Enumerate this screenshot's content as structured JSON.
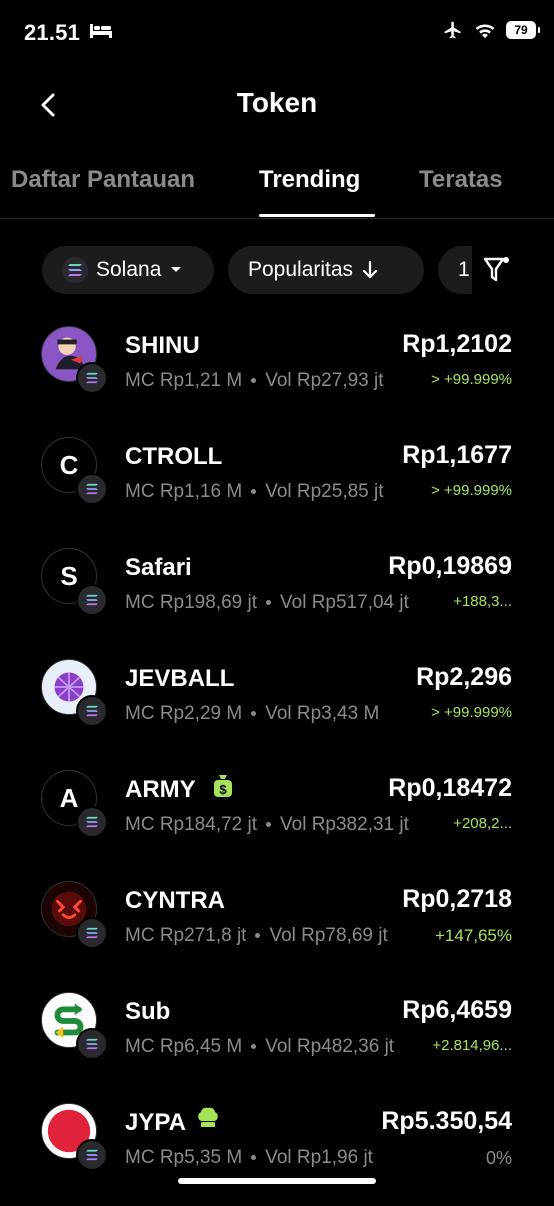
{
  "status": {
    "time": "21.51",
    "battery": "79"
  },
  "header": {
    "title": "Token"
  },
  "tabs": [
    {
      "label": "Daftar Pantauan"
    },
    {
      "label": "Trending"
    },
    {
      "label": "Teratas"
    }
  ],
  "filters": {
    "network": "Solana",
    "sort": "Popularitas",
    "time_cut": "1"
  },
  "tokens": [
    {
      "name": "SHINU",
      "price": "Rp1,2102",
      "mc": "MC Rp1,21 M",
      "vol": "Vol Rp27,93 jt",
      "change": "> +99.999%"
    },
    {
      "name": "CTROLL",
      "initial": "C",
      "price": "Rp1,1677",
      "mc": "MC Rp1,16 M",
      "vol": "Vol Rp25,85 jt",
      "change": "> +99.999%"
    },
    {
      "name": "Safari",
      "initial": "S",
      "price": "Rp0,19869",
      "mc": "MC Rp198,69 jt",
      "vol": "Vol Rp517,04 jt",
      "change": "+188,3..."
    },
    {
      "name": "JEVBALL",
      "price": "Rp2,296",
      "mc": "MC Rp2,29 M",
      "vol": "Vol Rp3,43 M",
      "change": "> +99.999%"
    },
    {
      "name": "ARMY",
      "initial": "A",
      "price": "Rp0,18472",
      "mc": "MC Rp184,72 jt",
      "vol": "Vol Rp382,31 jt",
      "change": "+208,2..."
    },
    {
      "name": "CYNTRA",
      "price": "Rp0,2718",
      "mc": "MC Rp271,8 jt",
      "vol": "Vol Rp78,69 jt",
      "change": "+147,65%"
    },
    {
      "name": "Sub",
      "price": "Rp6,4659",
      "mc": "MC Rp6,45 M",
      "vol": "Vol Rp482,36 jt",
      "change": "+2.814,96..."
    },
    {
      "name": "JYPA",
      "price": "Rp5.350,54",
      "mc": "MC Rp5,35 M",
      "vol": "Vol Rp1,96 jt",
      "change": "0%"
    }
  ],
  "colors": {
    "positive": "#a6e35b",
    "muted": "#8b8b8b",
    "pill": "#1c1c1e"
  }
}
